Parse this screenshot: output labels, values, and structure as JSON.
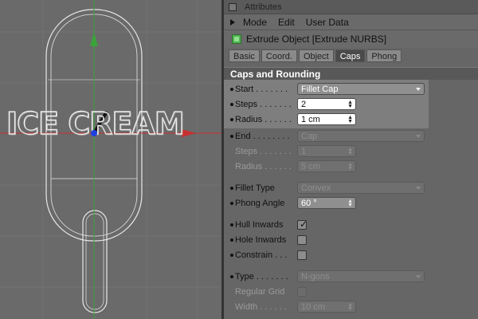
{
  "window": {
    "title": "Attributes"
  },
  "menu": {
    "items": [
      "Mode",
      "Edit",
      "User Data"
    ]
  },
  "object": {
    "name": "Extrude Object [Extrude NURBS]",
    "icon": "extrude-nurbs-icon"
  },
  "tabs": [
    "Basic",
    "Coord.",
    "Object",
    "Caps",
    "Phong"
  ],
  "active_tab": "Caps",
  "section": {
    "title": "Caps and Rounding"
  },
  "start": {
    "label": "Start . . . . . . .",
    "value": "Fillet Cap",
    "steps_label": "Steps . . . . . . .",
    "steps_value": "2",
    "radius_label": "Radius . . . . . .",
    "radius_value": "1 cm"
  },
  "end": {
    "label": "End . . . . . . . .",
    "value": "Cap",
    "steps_label": "Steps . . . . . . .",
    "steps_value": "1",
    "radius_label": "Radius . . . . . .",
    "radius_value": "5 cm"
  },
  "fillet": {
    "type_label": "Fillet Type",
    "type_value": "Convex",
    "phong_label": "Phong Angle",
    "phong_value": "60 °"
  },
  "options": {
    "hull_label": "Hull Inwards",
    "hull_checked": true,
    "hole_label": "Hole Inwards",
    "hole_checked": false,
    "constrain_label": "Constrain . . .",
    "constrain_checked": false
  },
  "type": {
    "label": "Type . . . . . . .",
    "value": "N-gons",
    "regular_label": "Regular Grid",
    "width_label": "Width . . . . . .",
    "width_value": "10 cm"
  },
  "viewport": {
    "text_3d": "ICE CREAM"
  },
  "colors": {
    "axis_y": "#3aa43a",
    "axis_x": "#c83030",
    "center": "#2040e0",
    "wire": "#e8e8e8"
  }
}
